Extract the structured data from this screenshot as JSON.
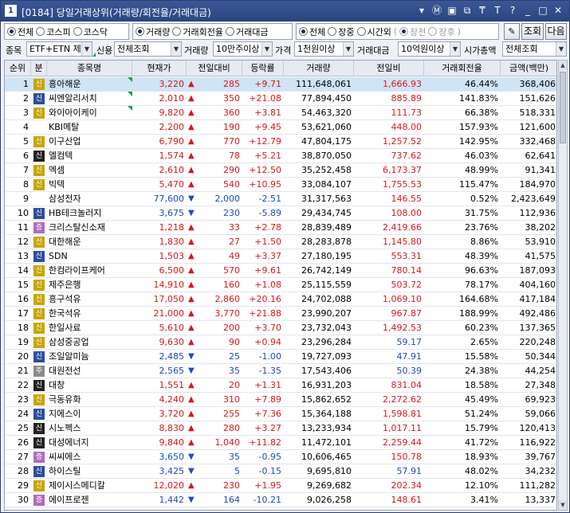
{
  "window": {
    "number": "1",
    "title": "[0184] 당일거래상위(거래량/회전율/거래대금)",
    "icons": [
      "chevron-down-icon",
      "m-icon",
      "tile-icon",
      "copy-icon",
      "pin-icon",
      "font-icon",
      "help-icon",
      "minimize-icon",
      "maximize-icon",
      "close-icon"
    ]
  },
  "filters": {
    "market": [
      {
        "label": "전체",
        "checked": true
      },
      {
        "label": "코스피",
        "checked": false
      },
      {
        "label": "코스닥",
        "checked": false
      }
    ],
    "sort": [
      {
        "label": "거래량",
        "checked": true
      },
      {
        "label": "거래회전율",
        "checked": false
      },
      {
        "label": "거래대금",
        "checked": false
      }
    ],
    "session": [
      {
        "label": "전체",
        "checked": true
      },
      {
        "label": "장중",
        "checked": false
      },
      {
        "label": "시간외",
        "checked": false
      }
    ],
    "session_sub": [
      {
        "label": "장전",
        "checked": true
      },
      {
        "label": "장후",
        "checked": false
      }
    ],
    "query_button": "조회",
    "next_button": "다음"
  },
  "conditions": {
    "stock_label": "종목",
    "stock_value": "ETF+ETN 제",
    "credit_label": "신용",
    "credit_value": "전체조회",
    "volume_label": "거래량",
    "volume_value": "10만주이상",
    "price_label": "가격",
    "price_value": "1천원이상",
    "amount_label": "거래대금",
    "amount_value": "10억원이상",
    "cap_label": "시가총액",
    "cap_value": "전체조회"
  },
  "table": {
    "headers": [
      "순위",
      "분",
      "종목명",
      "현재가",
      "전일대비",
      "등락률",
      "거래량",
      "전일비",
      "거래회전율",
      "금액(백만)"
    ],
    "rows": [
      {
        "rank": "1",
        "badge": "신",
        "badge_color": "#c9a400",
        "name": "흥아해운",
        "price": "3,220",
        "dir": "up",
        "diff": "285",
        "rate": "+9.71",
        "vol": "111,648,061",
        "prev": "1,666.93",
        "turn": "46.44%",
        "amt": "368,406",
        "flag": true
      },
      {
        "rank": "2",
        "badge": "신",
        "badge_color": "#2a4f9c",
        "name": "씨엔알리서치",
        "price": "2,010",
        "dir": "up",
        "diff": "350",
        "rate": "+21.08",
        "vol": "77,894,450",
        "prev": "885.89",
        "turn": "141.83%",
        "amt": "151,626",
        "flag": true
      },
      {
        "rank": "3",
        "badge": "신",
        "badge_color": "#c9a400",
        "name": "와이아이케이",
        "price": "9,820",
        "dir": "up",
        "diff": "360",
        "rate": "+3.81",
        "vol": "54,463,320",
        "prev": "111.73",
        "turn": "66.38%",
        "amt": "518,331",
        "flag": true
      },
      {
        "rank": "4",
        "badge": "",
        "badge_color": "",
        "name": "KBI메탈",
        "price": "2,200",
        "dir": "up",
        "diff": "190",
        "rate": "+9.45",
        "vol": "53,621,060",
        "prev": "448.00",
        "turn": "157.93%",
        "amt": "121,600",
        "flag": false
      },
      {
        "rank": "5",
        "badge": "신",
        "badge_color": "#c9a400",
        "name": "이구산업",
        "price": "6,790",
        "dir": "up",
        "diff": "770",
        "rate": "+12.79",
        "vol": "47,804,175",
        "prev": "1,257.52",
        "turn": "142.95%",
        "amt": "332,468",
        "flag": false
      },
      {
        "rank": "6",
        "badge": "신",
        "badge_color": "#222222",
        "name": "엘컴텍",
        "price": "1,574",
        "dir": "up",
        "diff": "78",
        "rate": "+5.21",
        "vol": "38,870,050",
        "prev": "737.62",
        "turn": "46.03%",
        "amt": "62,641",
        "flag": false
      },
      {
        "rank": "7",
        "badge": "신",
        "badge_color": "#c9a400",
        "name": "엑셈",
        "price": "2,610",
        "dir": "up",
        "diff": "290",
        "rate": "+12.50",
        "vol": "35,252,458",
        "prev": "6,173.37",
        "turn": "48.99%",
        "amt": "91,341",
        "flag": false
      },
      {
        "rank": "8",
        "badge": "신",
        "badge_color": "#c9a400",
        "name": "빅텍",
        "price": "5,470",
        "dir": "up",
        "diff": "540",
        "rate": "+10.95",
        "vol": "33,084,107",
        "prev": "1,755.53",
        "turn": "115.47%",
        "amt": "184,970",
        "flag": false
      },
      {
        "rank": "9",
        "badge": "",
        "badge_color": "",
        "name": "삼성전자",
        "price": "77,600",
        "dir": "down",
        "diff": "2,000",
        "rate": "-2.51",
        "vol": "31,317,563",
        "prev": "146.55",
        "turn": "0.52%",
        "amt": "2,423,649",
        "flag": false
      },
      {
        "rank": "10",
        "badge": "신",
        "badge_color": "#2a4f9c",
        "name": "HB테크놀러지",
        "price": "3,675",
        "dir": "down",
        "diff": "230",
        "rate": "-5.89",
        "vol": "29,434,745",
        "prev": "108.00",
        "turn": "31.75%",
        "amt": "112,936",
        "flag": false
      },
      {
        "rank": "11",
        "badge": "증",
        "badge_color": "#b06ac0",
        "name": "크리스탈신소재",
        "price": "1,218",
        "dir": "up",
        "diff": "33",
        "rate": "+2.78",
        "vol": "28,839,489",
        "prev": "2,419.66",
        "turn": "23.76%",
        "amt": "38,202",
        "flag": false
      },
      {
        "rank": "12",
        "badge": "신",
        "badge_color": "#c9a400",
        "name": "대한해운",
        "price": "1,830",
        "dir": "up",
        "diff": "27",
        "rate": "+1.50",
        "vol": "28,283,878",
        "prev": "1,145.80",
        "turn": "8.86%",
        "amt": "53,910",
        "flag": false
      },
      {
        "rank": "13",
        "badge": "신",
        "badge_color": "#2a4f9c",
        "name": "SDN",
        "price": "1,503",
        "dir": "up",
        "diff": "49",
        "rate": "+3.37",
        "vol": "27,180,195",
        "prev": "553.31",
        "turn": "48.39%",
        "amt": "41,575",
        "flag": false
      },
      {
        "rank": "14",
        "badge": "신",
        "badge_color": "#c9a400",
        "name": "한컴라이프케어",
        "price": "6,500",
        "dir": "up",
        "diff": "570",
        "rate": "+9.61",
        "vol": "26,742,149",
        "prev": "780.14",
        "turn": "96.63%",
        "amt": "187,093",
        "flag": false
      },
      {
        "rank": "15",
        "badge": "신",
        "badge_color": "#c9a400",
        "name": "제주은행",
        "price": "14,910",
        "dir": "up",
        "diff": "160",
        "rate": "+1.08",
        "vol": "25,115,559",
        "prev": "503.72",
        "turn": "78.17%",
        "amt": "404,160",
        "flag": false
      },
      {
        "rank": "16",
        "badge": "신",
        "badge_color": "#c9a400",
        "name": "흥구석유",
        "price": "17,050",
        "dir": "up",
        "diff": "2,860",
        "rate": "+20.16",
        "vol": "24,702,088",
        "prev": "1,069.10",
        "turn": "164.68%",
        "amt": "417,184",
        "flag": false
      },
      {
        "rank": "17",
        "badge": "신",
        "badge_color": "#c9a400",
        "name": "한국석유",
        "price": "21,000",
        "dir": "up",
        "diff": "3,770",
        "rate": "+21.88",
        "vol": "23,990,207",
        "prev": "967.87",
        "turn": "188.99%",
        "amt": "492,486",
        "flag": false
      },
      {
        "rank": "18",
        "badge": "신",
        "badge_color": "#c9a400",
        "name": "한일사료",
        "price": "5,610",
        "dir": "up",
        "diff": "200",
        "rate": "+3.70",
        "vol": "23,732,043",
        "prev": "1,492.53",
        "turn": "60.23%",
        "amt": "137,365",
        "flag": false
      },
      {
        "rank": "19",
        "badge": "신",
        "badge_color": "#c9a400",
        "name": "삼성중공업",
        "price": "9,630",
        "dir": "up",
        "diff": "90",
        "rate": "+0.94",
        "vol": "23,296,284",
        "prev": "59.17",
        "turn": "2.65%",
        "amt": "220,248",
        "flag": false
      },
      {
        "rank": "20",
        "badge": "신",
        "badge_color": "#2a4f9c",
        "name": "조일알미늄",
        "price": "2,485",
        "dir": "down",
        "diff": "25",
        "rate": "-1.00",
        "vol": "19,727,093",
        "prev": "47.91",
        "turn": "15.58%",
        "amt": "50,344",
        "flag": false
      },
      {
        "rank": "21",
        "badge": "주",
        "badge_color": "#8a8a8a",
        "name": "대원전선",
        "price": "2,565",
        "dir": "down",
        "diff": "35",
        "rate": "-1.35",
        "vol": "17,543,406",
        "prev": "50.39",
        "turn": "24.38%",
        "amt": "44,254",
        "flag": false
      },
      {
        "rank": "22",
        "badge": "신",
        "badge_color": "#222222",
        "name": "대창",
        "price": "1,551",
        "dir": "up",
        "diff": "20",
        "rate": "+1.31",
        "vol": "16,931,203",
        "prev": "831.04",
        "turn": "18.58%",
        "amt": "27,348",
        "flag": false
      },
      {
        "rank": "23",
        "badge": "신",
        "badge_color": "#c9a400",
        "name": "극동유화",
        "price": "4,240",
        "dir": "up",
        "diff": "310",
        "rate": "+7.89",
        "vol": "15,862,652",
        "prev": "2,272.62",
        "turn": "45.49%",
        "amt": "69,923",
        "flag": false
      },
      {
        "rank": "24",
        "badge": "신",
        "badge_color": "#2a4f9c",
        "name": "지에스이",
        "price": "3,720",
        "dir": "up",
        "diff": "255",
        "rate": "+7.36",
        "vol": "15,364,188",
        "prev": "1,598.81",
        "turn": "51.24%",
        "amt": "59,066",
        "flag": false
      },
      {
        "rank": "25",
        "badge": "신",
        "badge_color": "#222222",
        "name": "시노펙스",
        "price": "8,830",
        "dir": "up",
        "diff": "280",
        "rate": "+3.27",
        "vol": "13,233,934",
        "prev": "1,017.11",
        "turn": "15.79%",
        "amt": "120,413",
        "flag": false
      },
      {
        "rank": "26",
        "badge": "신",
        "badge_color": "#222222",
        "name": "대성에너지",
        "price": "9,840",
        "dir": "up",
        "diff": "1,040",
        "rate": "+11.82",
        "vol": "11,472,101",
        "prev": "2,259.44",
        "turn": "41.72%",
        "amt": "116,922",
        "flag": false
      },
      {
        "rank": "27",
        "badge": "증",
        "badge_color": "#b06ac0",
        "name": "씨씨에스",
        "price": "3,650",
        "dir": "down",
        "diff": "35",
        "rate": "-0.95",
        "vol": "10,606,465",
        "prev": "150.78",
        "turn": "18.93%",
        "amt": "39,767",
        "flag": false
      },
      {
        "rank": "28",
        "badge": "신",
        "badge_color": "#2a4f9c",
        "name": "하이스틸",
        "price": "3,425",
        "dir": "down",
        "diff": "5",
        "rate": "-0.15",
        "vol": "9,695,810",
        "prev": "57.91",
        "turn": "48.02%",
        "amt": "34,232",
        "flag": false
      },
      {
        "rank": "29",
        "badge": "신",
        "badge_color": "#c9a400",
        "name": "제이시스메디칼",
        "price": "12,020",
        "dir": "up",
        "diff": "230",
        "rate": "+1.95",
        "vol": "9,269,682",
        "prev": "202.34",
        "turn": "12.10%",
        "amt": "111,282",
        "flag": false
      },
      {
        "rank": "30",
        "badge": "증",
        "badge_color": "#b06ac0",
        "name": "에이프로젠",
        "price": "1,442",
        "dir": "down",
        "diff": "164",
        "rate": "-10.21",
        "vol": "9,026,258",
        "prev": "148.61",
        "turn": "3.41%",
        "amt": "13,337",
        "flag": false
      }
    ]
  },
  "colors": {
    "up": "#d8171b",
    "down": "#1a4bc9",
    "selected_row": "#cfe4f5"
  }
}
